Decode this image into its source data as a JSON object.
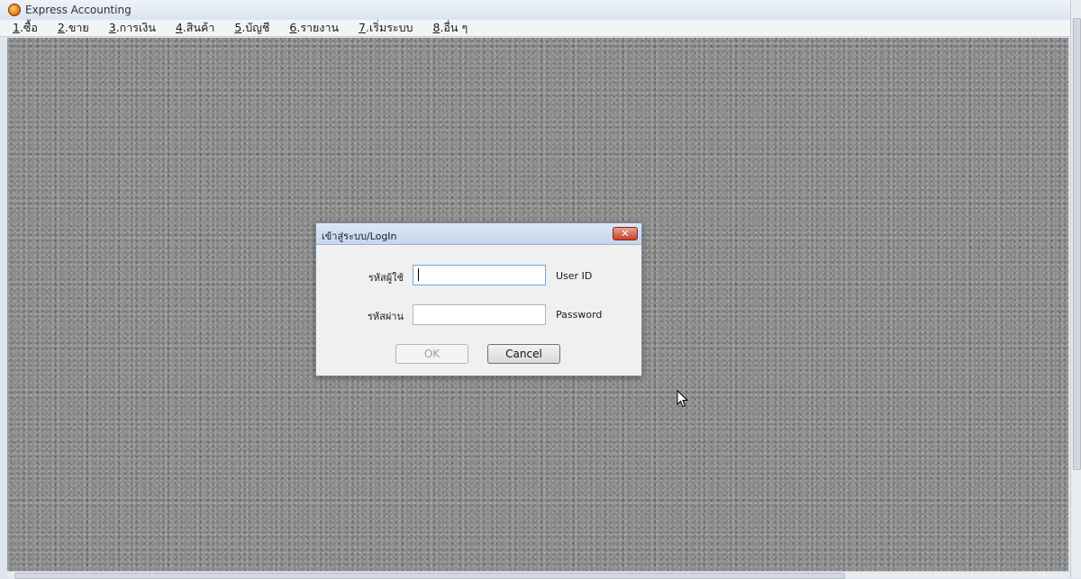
{
  "window": {
    "title": "Express Accounting",
    "icon": "express-logo-icon"
  },
  "menu": [
    {
      "accelerator": "1",
      "label": ".ซื้อ"
    },
    {
      "accelerator": "2",
      "label": ".ขาย"
    },
    {
      "accelerator": "3",
      "label": ".การเงิน"
    },
    {
      "accelerator": "4",
      "label": ".สินค้า"
    },
    {
      "accelerator": "5",
      "label": ".บัญชี"
    },
    {
      "accelerator": "6",
      "label": ".รายงาน"
    },
    {
      "accelerator": "7",
      "label": ".เริ่มระบบ"
    },
    {
      "accelerator": "8",
      "label": ".อื่น ๆ"
    }
  ],
  "dialog": {
    "title": "เข้าสู่ระบบ/LogIn",
    "close_label": "✕",
    "user_label": "รหัสผู้ใช้",
    "user_hint": "User ID",
    "user_value": "",
    "password_label": "รหัสผ่าน",
    "password_hint": "Password",
    "password_value": "",
    "ok_label": "OK",
    "cancel_label": "Cancel"
  },
  "colors": {
    "workspace_bg": "#8c8c8c",
    "close_button": "#c5412b"
  }
}
